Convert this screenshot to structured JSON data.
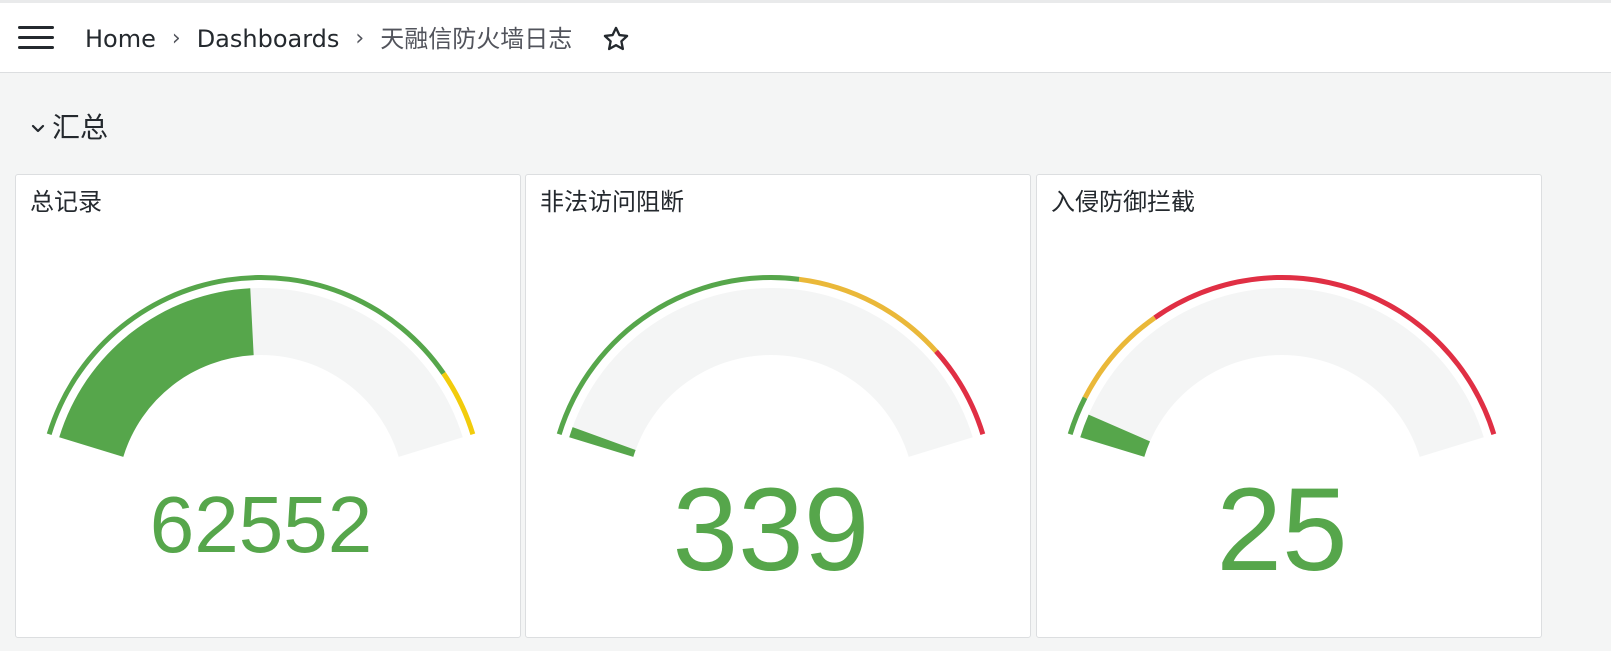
{
  "header": {
    "breadcrumb": {
      "home": "Home",
      "dashboards": "Dashboards",
      "current": "天融信防火墙日志"
    },
    "menu_icon": "hamburger-menu-icon",
    "star_icon": "star-icon"
  },
  "row": {
    "title": "汇总",
    "collapse_icon": "chevron-down-icon"
  },
  "panels": [
    {
      "title": "总记录",
      "value_text": "62552",
      "value_fill_fraction": 0.48,
      "value_color": "#56a64b",
      "threshold_segments": [
        {
          "from": 0.0,
          "to": 0.88,
          "color": "#56a64b"
        },
        {
          "from": 0.88,
          "to": 1.0,
          "color": "#f2cc0c"
        }
      ]
    },
    {
      "title": "非法访问阻断",
      "value_text": "339",
      "value_fill_fraction": 0.02,
      "value_color": "#56a64b",
      "threshold_segments": [
        {
          "from": 0.0,
          "to": 0.55,
          "color": "#56a64b"
        },
        {
          "from": 0.55,
          "to": 0.83,
          "color": "#eab839"
        },
        {
          "from": 0.83,
          "to": 1.0,
          "color": "#e02f44"
        }
      ]
    },
    {
      "title": "入侵防御拦截",
      "value_text": "25",
      "value_fill_fraction": 0.045,
      "value_color": "#56a64b",
      "threshold_segments": [
        {
          "from": 0.0,
          "to": 0.07,
          "color": "#56a64b"
        },
        {
          "from": 0.07,
          "to": 0.26,
          "color": "#eab839"
        },
        {
          "from": 0.26,
          "to": 1.0,
          "color": "#e02f44"
        }
      ]
    }
  ],
  "colors": {
    "track": "#f4f5f5",
    "panel_bg": "#ffffff",
    "page_bg": "#f4f5f5",
    "text": "#24292e"
  }
}
